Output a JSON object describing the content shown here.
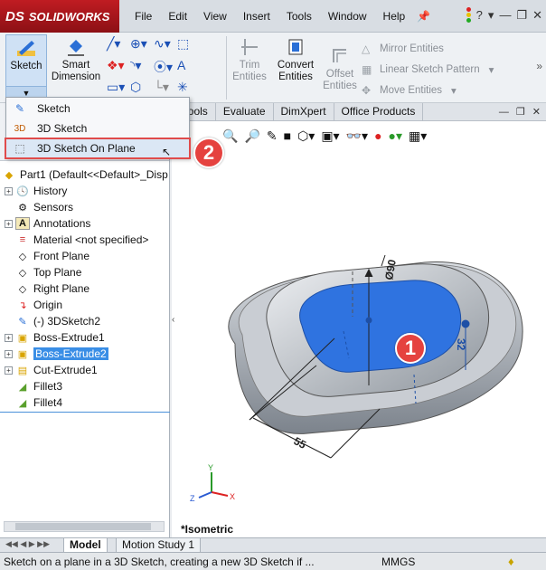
{
  "app": {
    "brand": "SOLIDWORKS",
    "brand_mark": "DS"
  },
  "menu": [
    "File",
    "Edit",
    "View",
    "Insert",
    "Tools",
    "Window",
    "Help"
  ],
  "command_manager": {
    "sketch_label": "Sketch",
    "smart_dimension_label": "Smart Dimension",
    "trim_entities_label": "Trim Entities",
    "convert_entities_label": "Convert Entities",
    "offset_entities_label": "Offset Entities",
    "mirror_entities_label": "Mirror Entities",
    "linear_sketch_pattern_label": "Linear Sketch Pattern",
    "move_entities_label": "Move Entities"
  },
  "sketch_dropdown": {
    "items": [
      {
        "label": "Sketch",
        "icon": "sketch-icon"
      },
      {
        "label": "3D Sketch",
        "icon": "3d-sketch-icon"
      },
      {
        "label": "3D Sketch On Plane",
        "icon": "3d-sketch-on-plane-icon",
        "highlighted": true
      }
    ]
  },
  "tabs": [
    "d Tools",
    "Evaluate",
    "DimXpert",
    "Office Products"
  ],
  "feature_tree": {
    "root": "Part1  (Default<<Default>_Disp",
    "items": [
      {
        "label": "History",
        "icon": "history-icon",
        "expandable": true
      },
      {
        "label": "Sensors",
        "icon": "sensors-icon",
        "expandable": false
      },
      {
        "label": "Annotations",
        "icon": "annotations-icon",
        "expandable": true
      },
      {
        "label": "Material <not specified>",
        "icon": "material-icon",
        "expandable": false
      },
      {
        "label": "Front Plane",
        "icon": "plane-icon",
        "expandable": false
      },
      {
        "label": "Top Plane",
        "icon": "plane-icon",
        "expandable": false
      },
      {
        "label": "Right Plane",
        "icon": "plane-icon",
        "expandable": false
      },
      {
        "label": "Origin",
        "icon": "origin-icon",
        "expandable": false
      },
      {
        "label": "(-) 3DSketch2",
        "icon": "3d-sketch-icon",
        "expandable": false
      },
      {
        "label": "Boss-Extrude1",
        "icon": "extrude-icon",
        "expandable": true
      },
      {
        "label": "Boss-Extrude2",
        "icon": "extrude-icon",
        "expandable": true,
        "selected": true
      },
      {
        "label": "Cut-Extrude1",
        "icon": "cut-extrude-icon",
        "expandable": true
      },
      {
        "label": "Fillet3",
        "icon": "fillet-icon",
        "expandable": false
      },
      {
        "label": "Fillet4",
        "icon": "fillet-icon",
        "expandable": false
      }
    ]
  },
  "viewport": {
    "view_label": "*Isometric",
    "dimensions": {
      "diameter": "Ø90",
      "height": "32",
      "length": "55"
    },
    "axes": {
      "x": "X",
      "y": "Y",
      "z": "Z"
    },
    "colors": {
      "body": "#b6bcc4",
      "face": "#2f73e0",
      "callout": "#e5423f"
    }
  },
  "callouts": {
    "first": "1",
    "second": "2"
  },
  "bottom_tabs": [
    "Model",
    "Motion Study 1"
  ],
  "status": {
    "message": "Sketch on a plane in a 3D Sketch, creating a new 3D Sketch if ...",
    "units": "MMGS"
  }
}
